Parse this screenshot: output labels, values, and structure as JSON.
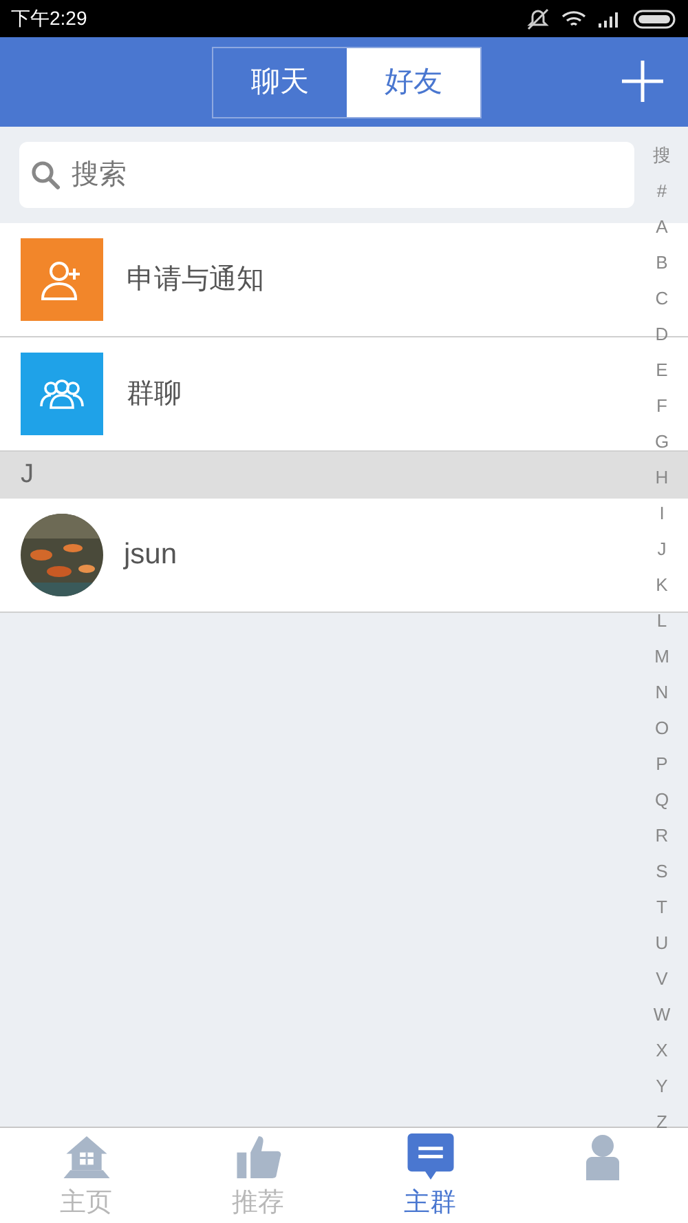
{
  "status_bar": {
    "time": "下午2:29"
  },
  "header": {
    "tabs": [
      {
        "label": "聊天",
        "selected": false
      },
      {
        "label": "好友",
        "selected": true
      }
    ]
  },
  "search": {
    "placeholder": "搜索"
  },
  "entries": [
    {
      "kind": "requests",
      "label": "申请与通知"
    },
    {
      "kind": "group",
      "label": "群聊"
    }
  ],
  "sections": [
    {
      "letter": "J",
      "contacts": [
        {
          "name": "jsun"
        }
      ]
    }
  ],
  "index": [
    "搜",
    "#",
    "A",
    "B",
    "C",
    "D",
    "E",
    "F",
    "G",
    "H",
    "I",
    "J",
    "K",
    "L",
    "M",
    "N",
    "O",
    "P",
    "Q",
    "R",
    "S",
    "T",
    "U",
    "V",
    "W",
    "X",
    "Y",
    "Z"
  ],
  "bottom_nav": [
    {
      "kind": "home",
      "label": "主页",
      "selected": false
    },
    {
      "kind": "like",
      "label": "推荐",
      "selected": false
    },
    {
      "kind": "chat",
      "label": "主群",
      "selected": true
    },
    {
      "kind": "person",
      "selected": false
    }
  ]
}
